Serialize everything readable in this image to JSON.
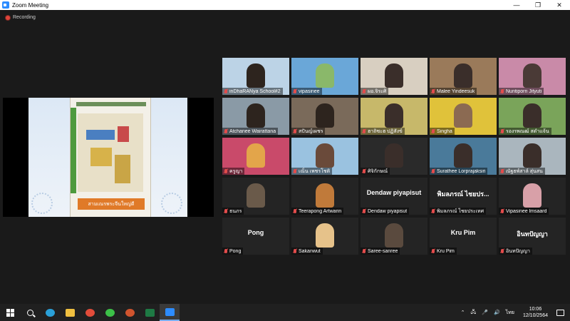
{
  "window": {
    "title": "Zoom Meeting",
    "controls": [
      "—",
      "❐",
      "✕"
    ]
  },
  "recording": {
    "label": "Recording"
  },
  "share": {
    "poster_label": "สามเณรพระจีนใหญ่ดี"
  },
  "participants": [
    {
      "name": "inDhaRANya School#2",
      "display": "",
      "bg": "#bcd3e6",
      "avatar": "#2d241e"
    },
    {
      "name": "vipasinee",
      "display": "",
      "bg": "#6aa7d8",
      "avatar": "#8ab86a"
    },
    {
      "name": "ผอ.จิระศิ",
      "display": "",
      "bg": "#d8cfc1",
      "avatar": "#3a2e2a",
      "active": true
    },
    {
      "name": "Malee Yindeesuk",
      "display": "",
      "bg": "#9a7a5a",
      "avatar": "#3a2e2a"
    },
    {
      "name": "Nuntiporn Jityuti",
      "display": "",
      "bg": "#c98aa8",
      "avatar": "#4a3a36"
    },
    {
      "name": "Atchanee Wairattana",
      "display": "",
      "bg": "#8a9aa6",
      "avatar": "#2d241e"
    },
    {
      "name": "สปันญ์เผชร",
      "display": "",
      "bg": "#7a6a5a",
      "avatar": "#2d241e"
    },
    {
      "name": "ฮาถิซะฮ ปฏิสังข์",
      "display": "",
      "bg": "#c7b86a",
      "avatar": "#3a2e2a"
    },
    {
      "name": "Singha",
      "display": "",
      "bg": "#e0c23a",
      "avatar": "#8b6a52"
    },
    {
      "name": "รองรพณฒ์ สดำแจ้น",
      "display": "",
      "bg": "#7aa45a",
      "avatar": "#3a2e2a"
    },
    {
      "name": "ครูญา",
      "display": "",
      "bg": "#c94a6a",
      "avatar": "#e3a54a"
    },
    {
      "name": "เณ็น เพชรโชติ",
      "display": "",
      "bg": "#9ac2e0",
      "avatar": "#6a4a3a"
    },
    {
      "name": "ศิจิกักษณ์",
      "display": "",
      "bg": "#2a2a2a",
      "avatar": "#3a2e2a"
    },
    {
      "name": "Surathee Lorprajaksiri",
      "display": "",
      "bg": "#4a7a9a",
      "avatar": "#3a2e2a"
    },
    {
      "name": "ณัฐธพ์สาล์ สุ่นสน",
      "display": "",
      "bg": "#aab6be",
      "avatar": "#3a2e2a"
    },
    {
      "name": "ธนภร",
      "display": "",
      "bg": "#242424",
      "avatar": "#6a5a4a"
    },
    {
      "name": "Teerapong Artwarin",
      "display": "",
      "bg": "#242424",
      "avatar": "#c07a3a"
    },
    {
      "name": "Dendaw piyapisut",
      "display": "Dendaw piyapisut",
      "bg": "#242424",
      "avatar": ""
    },
    {
      "name": "พิมลภรณ์ ไชยประเทศ",
      "display": "พิมลภรณ์ ไชยปร...",
      "bg": "#242424",
      "avatar": ""
    },
    {
      "name": "Vipasinee lmsaard",
      "display": "",
      "bg": "#242424",
      "avatar": "#d8a0a8"
    },
    {
      "name": "Pong",
      "display": "Pong",
      "bg": "#242424",
      "avatar": ""
    },
    {
      "name": "Sakanwut",
      "display": "",
      "bg": "#242424",
      "avatar": "#e6c28a"
    },
    {
      "name": "Saree-sanree",
      "display": "",
      "bg": "#242424",
      "avatar": "#5a4a3e"
    },
    {
      "name": "Kru Pim",
      "display": "Kru Pim",
      "bg": "#242424",
      "avatar": ""
    },
    {
      "name": "อินทปัญญา",
      "display": "อินทปัญญา",
      "bg": "#242424",
      "avatar": ""
    }
  ],
  "taskbar": {
    "apps": [
      {
        "name": "start",
        "color": "#ffffff"
      },
      {
        "name": "search",
        "color": "#ffffff"
      },
      {
        "name": "edge",
        "color": "#2aa0d8"
      },
      {
        "name": "explorer",
        "color": "#f0c040"
      },
      {
        "name": "chrome",
        "color": "#e24c3a"
      },
      {
        "name": "line",
        "color": "#3cc048"
      },
      {
        "name": "powerpoint",
        "color": "#d0542e"
      },
      {
        "name": "excel",
        "color": "#1e7a44"
      },
      {
        "name": "zoom",
        "color": "#2d8cff"
      }
    ],
    "tray_lang": "ไทย",
    "time": "10:06",
    "date": "12/10/2564"
  }
}
